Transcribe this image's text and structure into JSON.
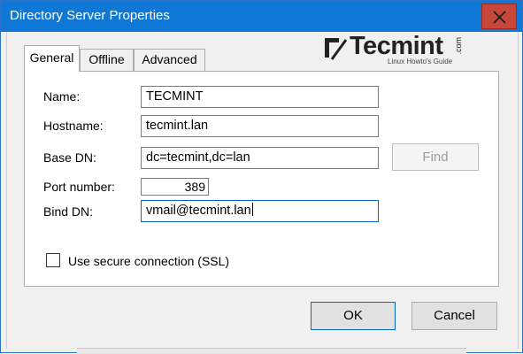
{
  "window": {
    "title": "Directory Server Properties"
  },
  "logo": {
    "brand": "Tecmint",
    "domain": ".com",
    "tagline": "Linux Howto's Guide"
  },
  "tabs": [
    {
      "label": "General",
      "active": true
    },
    {
      "label": "Offline",
      "active": false
    },
    {
      "label": "Advanced",
      "active": false
    }
  ],
  "form": {
    "name": {
      "label": "Name:",
      "value": "TECMINT"
    },
    "hostname": {
      "label": "Hostname:",
      "value": "tecmint.lan"
    },
    "base_dn": {
      "label": "Base DN:",
      "value": "dc=tecmint,dc=lan"
    },
    "port": {
      "label": "Port number:",
      "value": "389"
    },
    "bind_dn": {
      "label": "Bind DN:",
      "value": "vmail@tecmint.lan"
    },
    "find_label": "Find",
    "ssl": {
      "label": "Use secure connection (SSL)",
      "checked": false
    }
  },
  "buttons": {
    "ok": "OK",
    "cancel": "Cancel"
  },
  "colors": {
    "titlebar": "#0f78d7",
    "close": "#c9473a",
    "accent": "#0a66c2"
  }
}
